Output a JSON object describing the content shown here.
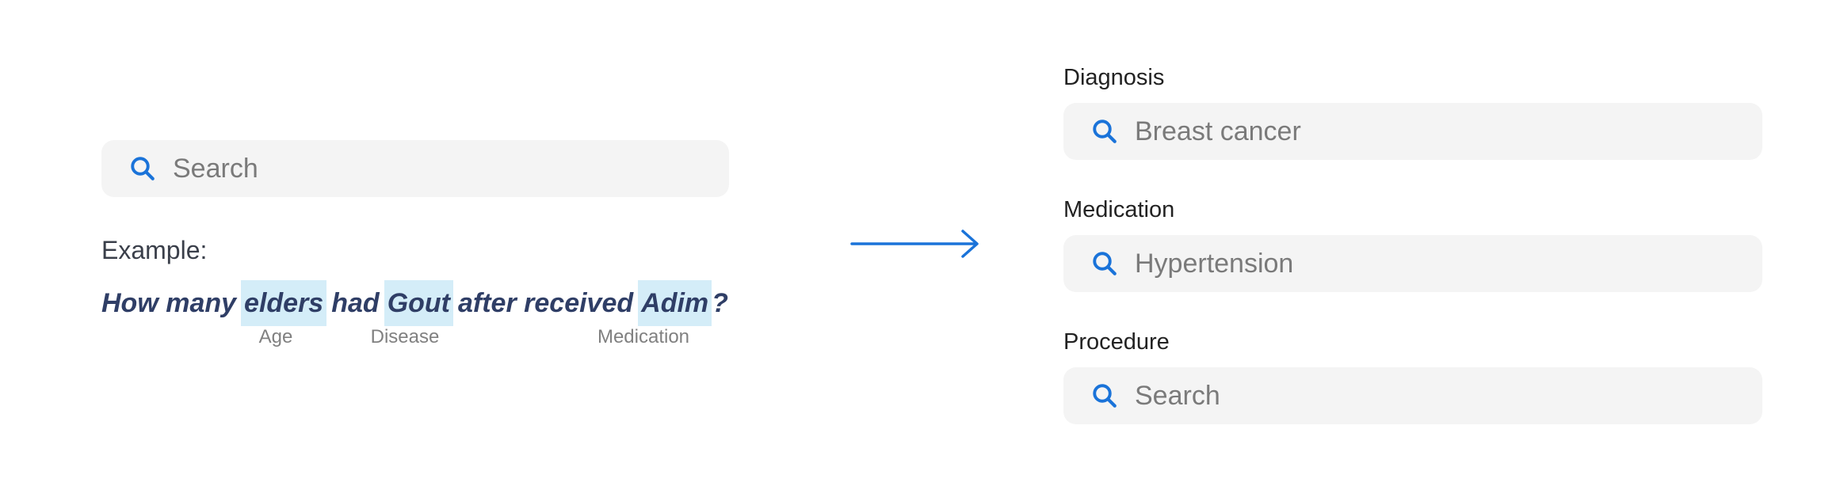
{
  "left": {
    "search": {
      "placeholder": "Search",
      "icon": "search-icon"
    },
    "example_label": "Example:",
    "question": {
      "segments": [
        {
          "text": "How many",
          "highlighted": false
        },
        {
          "text": "elders",
          "highlighted": true,
          "tag": "Age"
        },
        {
          "text": "had",
          "highlighted": false
        },
        {
          "text": "Gout",
          "highlighted": true,
          "tag": "Disease"
        },
        {
          "text": "after received",
          "highlighted": false
        },
        {
          "text": "Adim",
          "highlighted": true,
          "tag": "Medication"
        },
        {
          "text": "?",
          "highlighted": false
        }
      ]
    }
  },
  "arrow": {
    "icon": "arrow-right-icon"
  },
  "right": {
    "fields": [
      {
        "label": "Diagnosis",
        "value": "Breast cancer",
        "icon": "search-icon"
      },
      {
        "label": "Medication",
        "value": "Hypertension",
        "icon": "search-icon"
      },
      {
        "label": "Procedure",
        "placeholder": "Search",
        "icon": "search-icon"
      }
    ]
  },
  "colors": {
    "accent_blue": "#1a73d9",
    "highlight": "#d4edf8",
    "question_text": "#2f3e66",
    "search_bg": "#f4f4f4",
    "placeholder": "#7a7a7a",
    "tag_text": "#808080"
  }
}
